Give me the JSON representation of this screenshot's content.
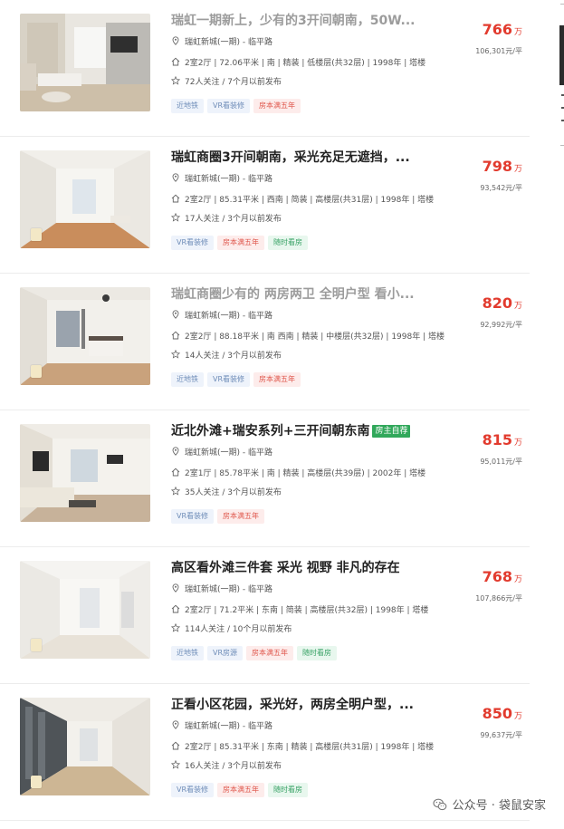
{
  "listings": [
    {
      "title": "瑞虹一期新上，少有的3开间朝南，50W...",
      "title_faded": true,
      "owner_tag": "",
      "community": "瑞虹新城(一期) - 临平路",
      "info": "2室2厅 | 72.06平米 | 南 | 精装 | 低楼层(共32层) | 1998年 | 塔楼",
      "follow": "72人关注 / 7个月以前发布",
      "tags": [
        {
          "text": "近地铁",
          "style": "blue"
        },
        {
          "text": "VR看装修",
          "style": "blue"
        },
        {
          "text": "房本满五年",
          "style": "red"
        }
      ],
      "price": "766",
      "price_unit": "万",
      "unit_price": "106,301元/平",
      "photo": "living-room-photo"
    },
    {
      "title": "瑞虹商圈3开间朝南，采光充足无遮挡，...",
      "title_faded": false,
      "owner_tag": "",
      "community": "瑞虹新城(一期) - 临平路",
      "info": "2室2厅 | 85.31平米 | 西南 | 简装 | 高楼层(共31层) | 1998年 | 塔楼",
      "follow": "17人关注 / 3个月以前发布",
      "tags": [
        {
          "text": "VR看装修",
          "style": "blue"
        },
        {
          "text": "房本满五年",
          "style": "red"
        },
        {
          "text": "随时看房",
          "style": "green"
        }
      ],
      "price": "798",
      "price_unit": "万",
      "unit_price": "93,542元/平",
      "photo": "empty-room-photo"
    },
    {
      "title": "瑞虹商圈少有的 两房两卫 全明户型 看小...",
      "title_faded": true,
      "owner_tag": "",
      "community": "瑞虹新城(一期) - 临平路",
      "info": "2室2厅 | 88.18平米 | 南 西南 | 精装 | 中楼层(共32层) | 1998年 | 塔楼",
      "follow": "14人关注 / 3个月以前发布",
      "tags": [
        {
          "text": "近地铁",
          "style": "blue"
        },
        {
          "text": "VR看装修",
          "style": "blue"
        },
        {
          "text": "房本满五年",
          "style": "red"
        }
      ],
      "price": "820",
      "price_unit": "万",
      "unit_price": "92,992元/平",
      "photo": "bedroom-photo"
    },
    {
      "title": "近北外滩+瑞安系列+三开间朝东南",
      "title_faded": false,
      "owner_tag": "房主自荐",
      "community": "瑞虹新城(一期) - 临平路",
      "info": "2室1厅 | 85.78平米 | 南 | 精装 | 高楼层(共39层) | 2002年 | 塔楼",
      "follow": "35人关注 / 3个月以前发布",
      "tags": [
        {
          "text": "VR看装修",
          "style": "blue"
        },
        {
          "text": "房本满五年",
          "style": "red"
        }
      ],
      "price": "815",
      "price_unit": "万",
      "unit_price": "95,011元/平",
      "photo": "sofa-living-room-photo"
    },
    {
      "title": "高区看外滩三件套 采光 视野 非凡的存在",
      "title_faded": false,
      "owner_tag": "",
      "community": "瑞虹新城(一期) - 临平路",
      "info": "2室2厅 | 71.2平米 | 东南 | 简装 | 高楼层(共32层) | 1998年 | 塔楼",
      "follow": "114人关注 / 10个月以前发布",
      "tags": [
        {
          "text": "近地铁",
          "style": "blue"
        },
        {
          "text": "VR房源",
          "style": "blue"
        },
        {
          "text": "房本满五年",
          "style": "red"
        },
        {
          "text": "随时看房",
          "style": "green"
        }
      ],
      "price": "768",
      "price_unit": "万",
      "unit_price": "107,866元/平",
      "photo": "white-room-photo"
    },
    {
      "title": "正看小区花园，采光好，两房全明户型，...",
      "title_faded": false,
      "owner_tag": "",
      "community": "瑞虹新城(一期) - 临平路",
      "info": "2室2厅 | 85.31平米 | 东南 | 精装 | 高楼层(共31层) | 1998年 | 塔楼",
      "follow": "16人关注 / 3个月以前发布",
      "tags": [
        {
          "text": "VR看装修",
          "style": "blue"
        },
        {
          "text": "房本满五年",
          "style": "red"
        },
        {
          "text": "随时看房",
          "style": "green"
        }
      ],
      "price": "850",
      "price_unit": "万",
      "unit_price": "99,637元/平",
      "photo": "hallway-photo"
    }
  ],
  "watermark": {
    "text": "公众号 · 袋鼠安家",
    "icon": "wechat-icon"
  },
  "colors": {
    "price": "#e23b2e",
    "owner_tag": "#31a85b"
  }
}
